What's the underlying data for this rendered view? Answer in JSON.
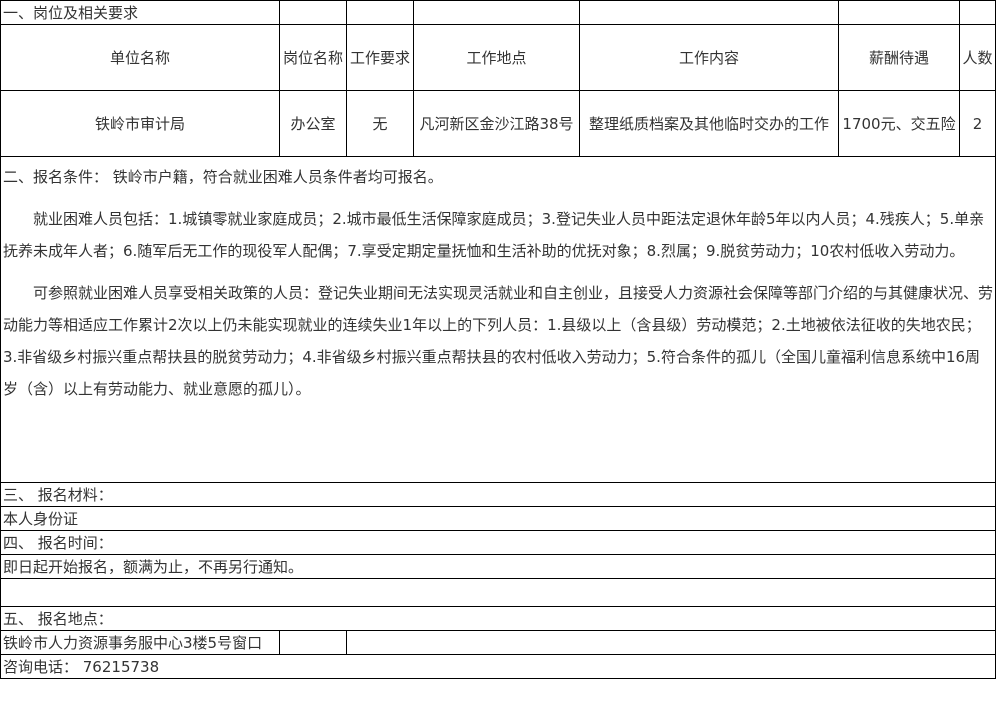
{
  "section1": {
    "title": "一、岗位及相关要求"
  },
  "headers": [
    "单位名称",
    "岗位名称",
    "工作要求",
    "工作地点",
    "工作内容",
    "薪酬待遇",
    "人数"
  ],
  "job": {
    "unit": "铁岭市审计局",
    "position": "办公室",
    "requirement": "无",
    "location": "凡河新区金沙江路38号",
    "content": "整理纸质档案及其他临时交办的工作",
    "salary": "1700元、交五险",
    "count": "2"
  },
  "section2": {
    "conditions": "二、报名条件：  铁岭市户籍，符合就业困难人员条件者均可报名。",
    "para1": "就业困难人员包括：1.城镇零就业家庭成员；2.城市最低生活保障家庭成员；3.登记失业人员中距法定退休年龄5年以内人员；4.残疾人；5.单亲抚养未成年人者；6.随军后无工作的现役军人配偶；7.享受定期定量抚恤和生活补助的优抚对象；8.烈属；9.脱贫劳动力；10农村低收入劳动力。",
    "para2": "可参照就业困难人员享受相关政策的人员：登记失业期间无法实现灵活就业和自主创业，且接受人力资源社会保障等部门介绍的与其健康状况、劳动能力等相适应工作累计2次以上仍未能实现就业的连续失业1年以上的下列人员：1.县级以上（含县级）劳动模范；2.土地被依法征收的失地农民；3.非省级乡村振兴重点帮扶县的脱贫劳动力；4.非省级乡村振兴重点帮扶县的农村低收入劳动力；5.符合条件的孤儿（全国儿童福利信息系统中16周岁（含）以上有劳动能力、就业意愿的孤儿）。"
  },
  "section3": {
    "title": "三、  报名材料：",
    "value": "本人身份证"
  },
  "section4": {
    "title": "四、  报名时间：",
    "value": "即日起开始报名，额满为止，不再另行通知。"
  },
  "section5": {
    "title": "五、  报名地点：",
    "value": "铁岭市人力资源事务服中心3楼5号窗口"
  },
  "contact": "咨询电话：  76215738"
}
